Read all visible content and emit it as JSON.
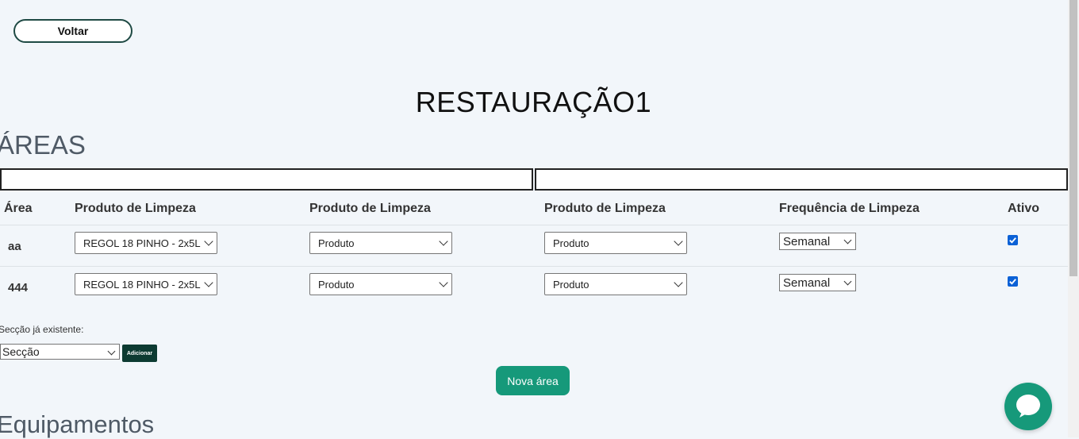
{
  "back_label": "Voltar",
  "page_title": "RESTAURAÇÃO1",
  "areas_title": "ÁREAS",
  "table": {
    "headers": [
      "Área",
      "Produto de Limpeza",
      "Produto de Limpeza",
      "Produto de Limpeza",
      "Frequência de Limpeza",
      "Ativo"
    ],
    "rows": [
      {
        "area": "aa",
        "produto1": "REGOL 18 PINHO - 2x5L",
        "produto2": "Produto",
        "produto3": "Produto",
        "frequencia": "Semanal",
        "ativo": true
      },
      {
        "area": "444",
        "produto1": "REGOL 18 PINHO - 2x5L",
        "produto2": "Produto",
        "produto3": "Produto",
        "frequencia": "Semanal",
        "ativo": true
      }
    ]
  },
  "existing_section": {
    "label": "Secção já existente:",
    "select_value": "Secção",
    "add_label": "Adicionar"
  },
  "new_area_label": "Nova área",
  "equipment_title": "Equipamentos",
  "colors": {
    "accent": "#16997a",
    "dark_button": "#0d3b32",
    "checkbox": "#0b61d6",
    "background": "#f2f6fa"
  }
}
